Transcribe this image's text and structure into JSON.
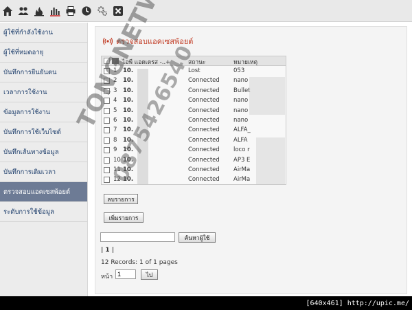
{
  "toolbar": {
    "icons": [
      "home-icon",
      "users-icon",
      "fire-icon",
      "chart-icon",
      "printer-icon",
      "clock-icon",
      "settings-icon",
      "close-icon"
    ]
  },
  "sidebar": {
    "items": [
      {
        "label": "ผู้ใช้ที่กำลังใช้งาน"
      },
      {
        "label": "ผู้ใช้ที่หมดอายุ"
      },
      {
        "label": "บันทึกการยืนยันตน"
      },
      {
        "label": "เวลาการใช้งาน"
      },
      {
        "label": "ข้อมูลการใช้งาน"
      },
      {
        "label": "บันทึกการใช้เว็บไซต์"
      },
      {
        "label": "บันทึกเส้นทางข้อมูล"
      },
      {
        "label": "บันทึกการเติมเวลา"
      },
      {
        "label": "ตรวจสอบแอคเซสพ้อยต์"
      },
      {
        "label": "ระดับการใช้ข้อมูล"
      }
    ]
  },
  "main": {
    "title": "ตรวจสอบแอคเซสพ้อยต์",
    "columns": {
      "ip": "ไอพี แอดเดรส -..+",
      "status": "สถานะ",
      "note": "หมายเหตุ"
    },
    "rows": [
      {
        "num": "1",
        "ip": "10.",
        "status": "Lost",
        "note": "053"
      },
      {
        "num": "2",
        "ip": "10.",
        "status": "Connected",
        "note": "nano"
      },
      {
        "num": "3",
        "ip": "10.",
        "status": "Connected",
        "note": "Bullet"
      },
      {
        "num": "4",
        "ip": "10.",
        "status": "Connected",
        "note": "nano"
      },
      {
        "num": "5",
        "ip": "10.",
        "status": "Connected",
        "note": "nano"
      },
      {
        "num": "6",
        "ip": "10.",
        "status": "Connected",
        "note": "nano"
      },
      {
        "num": "7",
        "ip": "10.",
        "status": "Connected",
        "note": "ALFA_"
      },
      {
        "num": "8",
        "ip": "10.",
        "status": "Connected",
        "note": "ALFA"
      },
      {
        "num": "9",
        "ip": "10.",
        "status": "Connected",
        "note": "loco r"
      },
      {
        "num": "10",
        "ip": "10.",
        "status": "Connected",
        "note": "AP3 E"
      },
      {
        "num": "11",
        "ip": "10.",
        "status": "Connected",
        "note": "AirMa"
      },
      {
        "num": "12",
        "ip": "10.",
        "status": "Connected",
        "note": "AirMa"
      }
    ],
    "delete_label": "ลบรายการ",
    "add_label": "เพิ่มรายการ",
    "search_button": "ค้นหาผู้ใช้",
    "pagination": "| 1 |",
    "records": "12 Records: 1 of 1 pages",
    "page_label": "หน้า",
    "page_value": "1",
    "go_label": "ไป"
  },
  "watermark": {
    "line1": "TONGNETWORK_IT",
    "line2": "0875426540"
  },
  "footer": "[640x461] http://upic.me/",
  "colors": {
    "title": "#c23d26",
    "sidebar_active": "#6d7b95",
    "sidebar_text": "#1c3d6b"
  }
}
